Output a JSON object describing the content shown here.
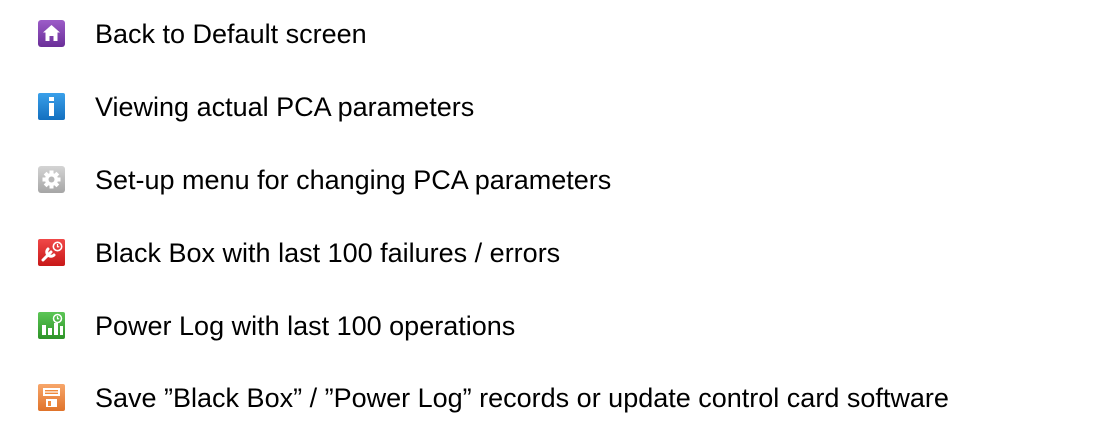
{
  "legend": {
    "items": [
      {
        "icon": "home-icon",
        "color": "#7a3ea8",
        "label": "Back to Default screen"
      },
      {
        "icon": "info-icon",
        "color": "#1e87d6",
        "label": "Viewing actual PCA parameters"
      },
      {
        "icon": "gear-icon",
        "color": "#b8b8b8",
        "label": "Set-up menu for changing PCA parameters"
      },
      {
        "icon": "wrench-clock-icon",
        "color": "#e32a2a",
        "label": "Black Box with last 100 failures / errors"
      },
      {
        "icon": "bar-chart-clock-icon",
        "color": "#3fae3a",
        "label": "Power Log with last 100 operations"
      },
      {
        "icon": "save-icon",
        "color": "#f08a3c",
        "label": "Save ”Black Box” / ”Power Log” records or update control card software"
      }
    ]
  }
}
